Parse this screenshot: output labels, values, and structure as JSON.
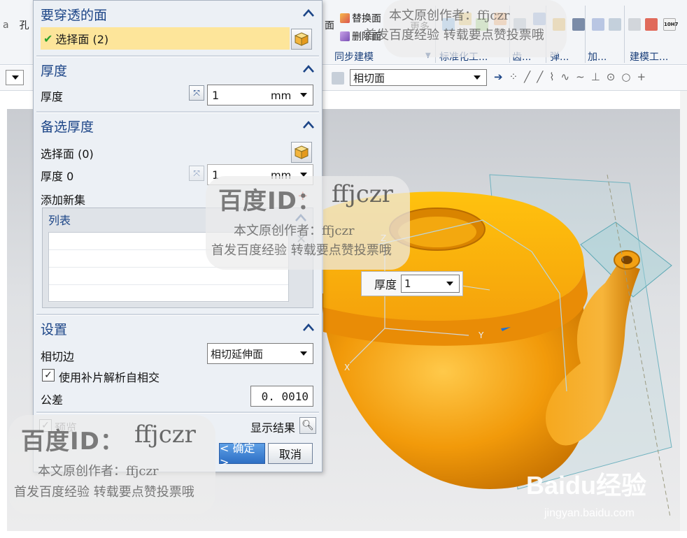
{
  "ribbon": {
    "left_partial_label": "孔",
    "face_label": "面",
    "replace_face": "替换面",
    "delete_face": "删除面",
    "more": "更多",
    "groups": [
      "同步建模",
      "标准化工...",
      "齿...",
      "弹...",
      "加...",
      "建模工..."
    ],
    "ten_h7_icon_text": "10H7"
  },
  "command_bar": {
    "face_rule_value": "相切面"
  },
  "dialog": {
    "faces_to_pierce": {
      "title": "要穿透的面",
      "selection_label": "选择面 (2)"
    },
    "thickness": {
      "title": "厚度",
      "label": "厚度",
      "value": "1",
      "unit": "mm"
    },
    "alternate_thickness": {
      "title": "备选厚度",
      "select_face": "选择面 (0)",
      "thickness_label": "厚度 0",
      "value": "1",
      "unit": "mm",
      "add_new_set": "添加新集",
      "list_title": "列表"
    },
    "settings": {
      "title": "设置",
      "tangent_edge_label": "相切边",
      "tangent_edge_value": "相切延伸面",
      "use_patch_label": "使用补片解析自相交",
      "use_patch_checked": true,
      "tolerance_label": "公差",
      "tolerance_value": "0. 0010"
    },
    "preview_label": "预览",
    "show_result_label": "显示结果",
    "ok_label": "< 确定 >",
    "cancel_label": "取消"
  },
  "graphics": {
    "floating_label": "厚度",
    "floating_value": "1",
    "axis_labels": [
      "Z",
      "Y",
      "X"
    ]
  },
  "watermarks": {
    "id_prefix": "百度ID：",
    "id_value": "ffjczr",
    "author_line": "本文原创作者：ffjczr",
    "promo_line": "首发百度经验 转载要点赞投票哦",
    "baidu_logo": "Baidu经验",
    "baidu_url": "jingyan.baidu.com"
  },
  "colors": {
    "accent": "#1c4587",
    "selection": "#fde59a",
    "part_orange": "#f5a20b"
  }
}
